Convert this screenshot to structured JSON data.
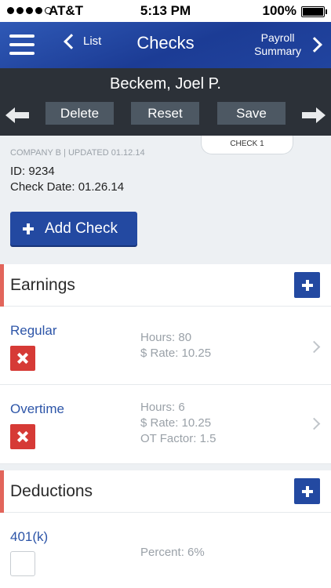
{
  "status_bar": {
    "carrier": "AT&T",
    "time": "5:13 PM",
    "battery": "100%",
    "signal_bars_filled": 4,
    "signal_bars_total": 5
  },
  "navbar": {
    "back_label": "List",
    "title": "Checks",
    "next_label_line1": "Payroll",
    "next_label_line2": "Summary"
  },
  "record": {
    "employee_name": "Beckem, Joel P.",
    "delete_label": "Delete",
    "reset_label": "Reset",
    "save_label": "Save"
  },
  "check_info": {
    "tab_label": "CHECK 1",
    "meta": "COMPANY B | UPDATED 01.12.14",
    "id_line": "ID: 9234",
    "date_line": "Check Date: 01.26.14",
    "add_check_label": "Add Check"
  },
  "earnings": {
    "heading": "Earnings",
    "items": [
      {
        "title": "Regular",
        "details": [
          "Hours: 80",
          "$ Rate: 10.25"
        ]
      },
      {
        "title": "Overtime",
        "details": [
          "Hours: 6",
          "$ Rate: 10.25",
          "OT Factor: 1.5"
        ]
      }
    ]
  },
  "deductions": {
    "heading": "Deductions",
    "items": [
      {
        "title": "401(k)",
        "details": [
          "Percent: 6%"
        ]
      }
    ]
  },
  "colors": {
    "nav_blue": "#21449f",
    "record_bar": "#2c3138",
    "section_marker": "#e2655b",
    "link_blue": "#2d55a8",
    "remove_red": "#d63a36"
  }
}
